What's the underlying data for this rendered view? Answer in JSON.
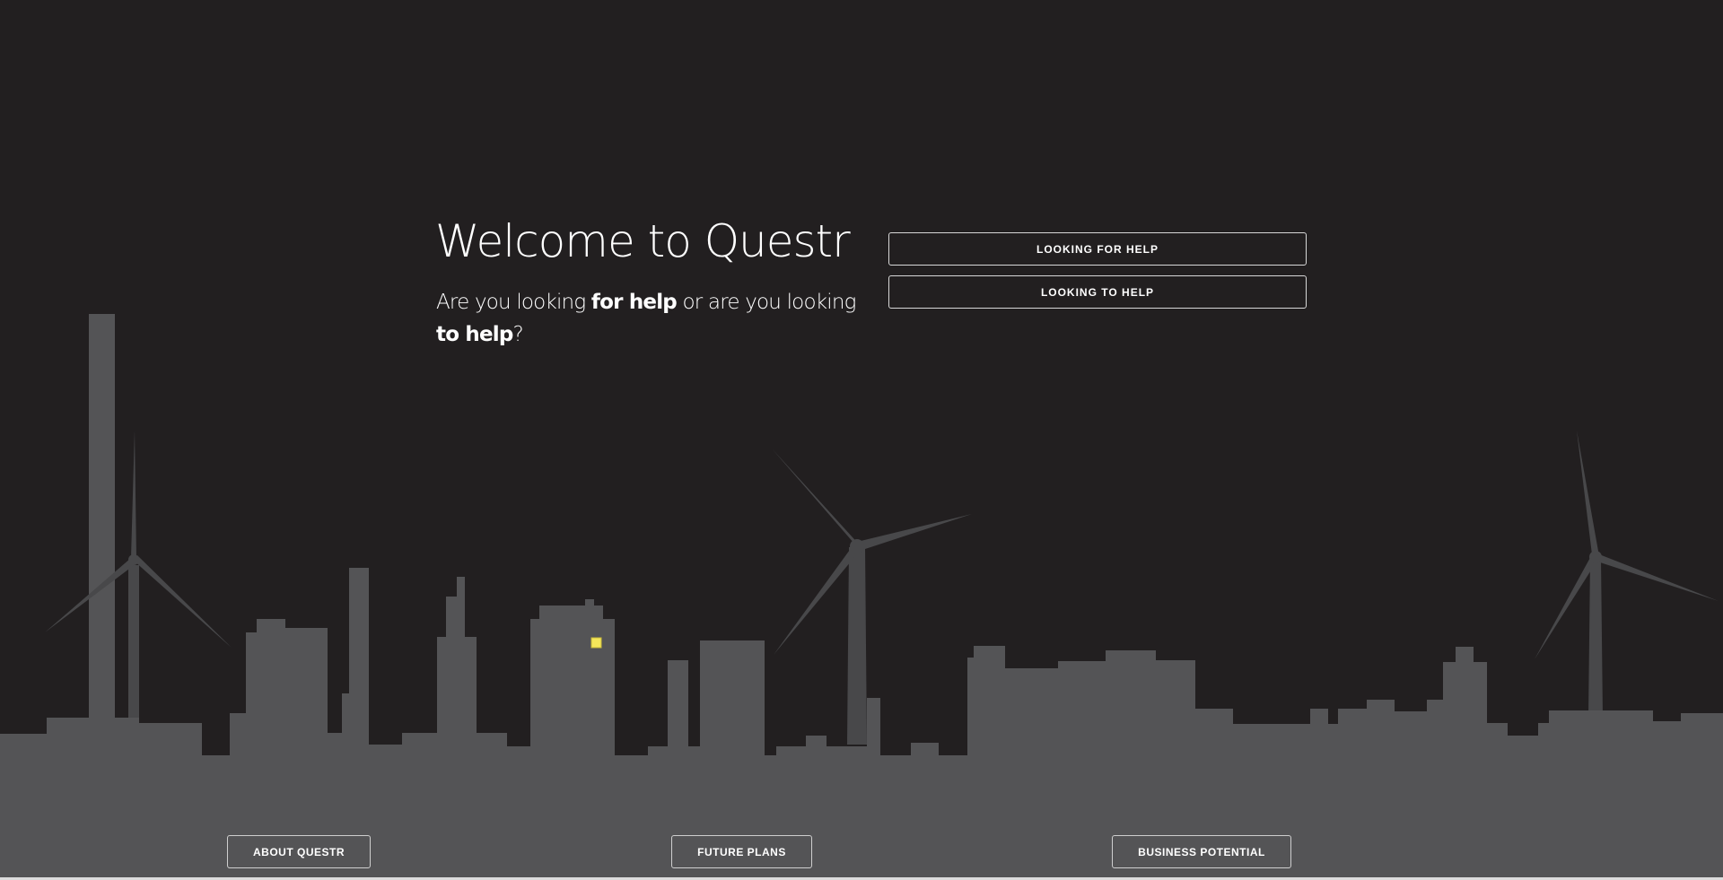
{
  "hero": {
    "title": "Welcome to Questr",
    "subtitle_part1": "Are you looking ",
    "subtitle_bold1": "for help",
    "subtitle_part2": " or are you looking ",
    "subtitle_bold2": "to help",
    "subtitle_part3": "?"
  },
  "choices": {
    "looking_for_help": "LOOKING FOR HELP",
    "looking_to_help": "LOOKING TO HELP"
  },
  "footer_nav": {
    "about": "ABOUT QUESTR",
    "future": "FUTURE PLANS",
    "business": "BUSINESS POTENTIAL"
  },
  "colors": {
    "background": "#221f20",
    "skyline": "#545456",
    "turbine": "#48484a",
    "window_light": "#f4e65a",
    "text": "#ffffff"
  }
}
